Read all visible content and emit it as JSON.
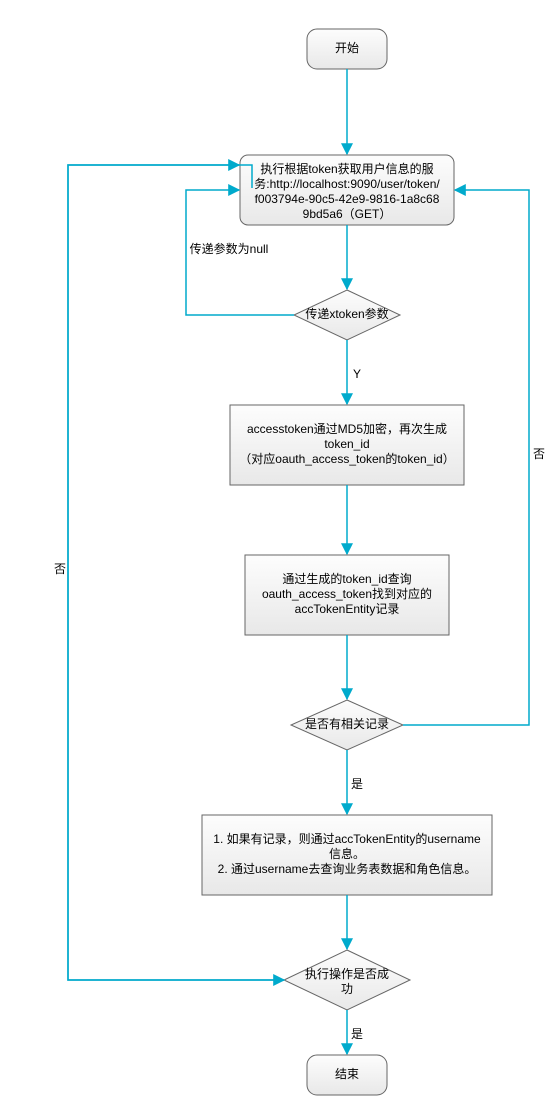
{
  "chart_data": {
    "type": "flowchart",
    "nodes": [
      {
        "id": "start",
        "shape": "rounded",
        "text": "开始"
      },
      {
        "id": "svc",
        "shape": "rounded",
        "text_lines": [
          "执行根据token获取用户信息的服",
          "务:http://localhost:9090/user/token/",
          "f003794e-90c5-42e9-9816-1a8c68",
          "9bd5a6（GET）"
        ]
      },
      {
        "id": "dec1",
        "shape": "diamond",
        "text": "传递xtoken参数"
      },
      {
        "id": "md5",
        "shape": "rect",
        "text_lines": [
          "accesstoken通过MD5加密，再次生成",
          "token_id",
          "（对应oauth_access_token的token_id）"
        ]
      },
      {
        "id": "query",
        "shape": "rect",
        "text_lines": [
          "通过生成的token_id查询",
          "oauth_access_token找到对应的",
          "accTokenEntity记录"
        ]
      },
      {
        "id": "dec2",
        "shape": "diamond",
        "text": "是否有相关记录"
      },
      {
        "id": "proc",
        "shape": "rect",
        "text_lines": [
          "1. 如果有记录，则通过accTokenEntity的username",
          "信息。",
          "2. 通过username去查询业务表数据和角色信息。"
        ]
      },
      {
        "id": "dec3",
        "shape": "diamond",
        "text": "执行操作是否成功"
      },
      {
        "id": "end",
        "shape": "rounded",
        "text": "结束"
      }
    ],
    "edges": [
      {
        "from": "start",
        "to": "svc",
        "label": ""
      },
      {
        "from": "svc",
        "to": "dec1",
        "label": ""
      },
      {
        "from": "dec1",
        "to": "svc",
        "label": "传递参数为null",
        "path": "left-up"
      },
      {
        "from": "dec1",
        "to": "md5",
        "label": "Y"
      },
      {
        "from": "md5",
        "to": "query",
        "label": ""
      },
      {
        "from": "query",
        "to": "dec2",
        "label": ""
      },
      {
        "from": "dec2",
        "to": "proc",
        "label": "是"
      },
      {
        "from": "dec2",
        "to": "svc",
        "label": "否",
        "path": "right-up"
      },
      {
        "from": "proc",
        "to": "dec3",
        "label": ""
      },
      {
        "from": "dec3",
        "to": "end",
        "label": "是"
      },
      {
        "from": "dec3",
        "to": "svc",
        "label": "否",
        "path": "far-left-up"
      }
    ]
  },
  "labels": {
    "start": "开始",
    "svc1": "执行根据token获取用户信息的服",
    "svc2": "务:http://localhost:9090/user/token/",
    "svc3": "f003794e-90c5-42e9-9816-1a8c68",
    "svc4": "9bd5a6（GET）",
    "dec1": "传递xtoken参数",
    "md5_1": "accesstoken通过MD5加密，再次生成",
    "md5_2": "token_id",
    "md5_3": "（对应oauth_access_token的token_id）",
    "query_1": "通过生成的token_id查询",
    "query_2": "oauth_access_token找到对应的",
    "query_3": "accTokenEntity记录",
    "dec2": "是否有相关记录",
    "proc_1": "1. 如果有记录，则通过accTokenEntity的username",
    "proc_2": "信息。",
    "proc_3": "2. 通过username去查询业务表数据和角色信息。",
    "dec3_1": "执行操作是否成",
    "dec3_2": "功",
    "end": "结束",
    "edge_null": "传递参数为null",
    "edge_Y": "Y",
    "edge_yes": "是",
    "edge_no_right": "否",
    "edge_no_left": "否",
    "edge_yes2": "是"
  }
}
